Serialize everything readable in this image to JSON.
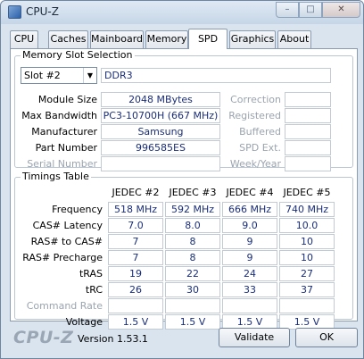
{
  "window": {
    "title": "CPU-Z"
  },
  "controls": {
    "minimize": "–",
    "maximize": "□",
    "close": "✕"
  },
  "tabs": [
    "CPU",
    "Caches",
    "Mainboard",
    "Memory",
    "SPD",
    "Graphics",
    "About"
  ],
  "active_tab": "SPD",
  "slot_group": {
    "legend": "Memory Slot Selection",
    "slot_value": "Slot #2",
    "memory_type": "DDR3",
    "left_fields": [
      {
        "label": "Module Size",
        "value": "2048 MBytes",
        "dim": false
      },
      {
        "label": "Max Bandwidth",
        "value": "PC3-10700H (667 MHz)",
        "dim": false
      },
      {
        "label": "Manufacturer",
        "value": "Samsung",
        "dim": false
      },
      {
        "label": "Part Number",
        "value": "996585ES",
        "dim": false
      },
      {
        "label": "Serial Number",
        "value": "",
        "dim": true
      }
    ],
    "right_fields": [
      {
        "label": "Correction",
        "value": ""
      },
      {
        "label": "Registered",
        "value": ""
      },
      {
        "label": "Buffered",
        "value": ""
      },
      {
        "label": "SPD Ext.",
        "value": ""
      },
      {
        "label": "Week/Year",
        "value": ""
      }
    ]
  },
  "timings": {
    "legend": "Timings Table",
    "columns": [
      "JEDEC #2",
      "JEDEC #3",
      "JEDEC #4",
      "JEDEC #5"
    ],
    "rows": [
      {
        "label": "Frequency",
        "values": [
          "518 MHz",
          "592 MHz",
          "666 MHz",
          "740 MHz"
        ],
        "dim": false
      },
      {
        "label": "CAS# Latency",
        "values": [
          "7.0",
          "8.0",
          "9.0",
          "10.0"
        ],
        "dim": false
      },
      {
        "label": "RAS# to CAS#",
        "values": [
          "7",
          "8",
          "9",
          "10"
        ],
        "dim": false
      },
      {
        "label": "RAS# Precharge",
        "values": [
          "7",
          "8",
          "9",
          "10"
        ],
        "dim": false
      },
      {
        "label": "tRAS",
        "values": [
          "19",
          "22",
          "24",
          "27"
        ],
        "dim": false
      },
      {
        "label": "tRC",
        "values": [
          "26",
          "30",
          "33",
          "37"
        ],
        "dim": false
      },
      {
        "label": "Command Rate",
        "values": [
          "",
          "",
          "",
          ""
        ],
        "dim": true
      },
      {
        "label": "Voltage",
        "values": [
          "1.5 V",
          "1.5 V",
          "1.5 V",
          "1.5 V"
        ],
        "dim": false
      }
    ]
  },
  "footer": {
    "logo": "CPU-Z",
    "version": "Version 1.53.1",
    "validate_label": "Validate",
    "ok_label": "OK"
  },
  "colors": {
    "value_text": "#1a2e7a",
    "window_bg": "#d9e4ef",
    "disabled_text": "#9aa4af"
  }
}
